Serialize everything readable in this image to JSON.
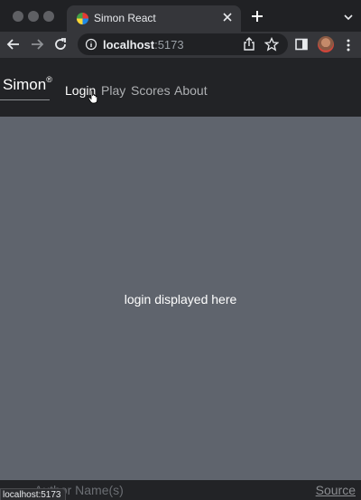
{
  "browser": {
    "tab": {
      "title": "Simon React",
      "favicon": "simon-favicon-icon"
    },
    "address": {
      "host": "localhost",
      "port": ":5173"
    },
    "status_url": "localhost:5173"
  },
  "header": {
    "brand": "Simon",
    "brand_mark": "®",
    "nav": [
      "Login",
      "Play",
      "Scores",
      "About"
    ],
    "active": "Login"
  },
  "main": {
    "placeholder": "login displayed here"
  },
  "footer": {
    "author": "Author Name(s)",
    "source": "Source"
  },
  "colors": {
    "main_bg": "#5f646d",
    "header_bg": "#222326",
    "chrome_bg": "#35363a"
  }
}
